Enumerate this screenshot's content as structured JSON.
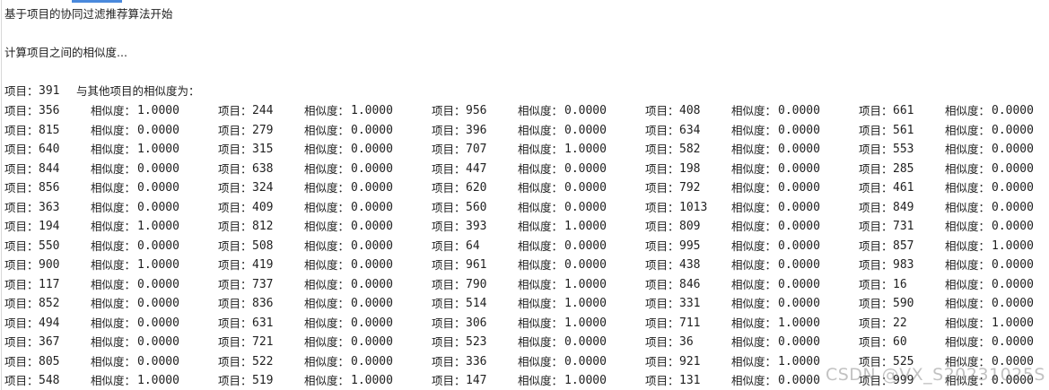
{
  "colors": {
    "background": "#ffffff",
    "text": "#1f1f1f",
    "tab_accent": "#4a89dc",
    "watermark": "#9a9a9a"
  },
  "console": {
    "line1": "基于项目的协同过滤推荐算法开始",
    "line2": "计算项目之间的相似度...",
    "header": {
      "item_label": "项目：",
      "item_id": "391",
      "suffix": "与其他项目的相似度为："
    },
    "item_label": "项目：",
    "sim_label": "相似度：",
    "rows": [
      [
        [
          "356",
          "1.0000"
        ],
        [
          "244",
          "1.0000"
        ],
        [
          "956",
          "0.0000"
        ],
        [
          "408",
          "0.0000"
        ],
        [
          "661",
          "0.0000"
        ]
      ],
      [
        [
          "815",
          "0.0000"
        ],
        [
          "279",
          "0.0000"
        ],
        [
          "396",
          "0.0000"
        ],
        [
          "634",
          "0.0000"
        ],
        [
          "561",
          "0.0000"
        ]
      ],
      [
        [
          "640",
          "1.0000"
        ],
        [
          "315",
          "0.0000"
        ],
        [
          "707",
          "1.0000"
        ],
        [
          "582",
          "0.0000"
        ],
        [
          "553",
          "0.0000"
        ]
      ],
      [
        [
          "844",
          "0.0000"
        ],
        [
          "638",
          "0.0000"
        ],
        [
          "447",
          "0.0000"
        ],
        [
          "198",
          "0.0000"
        ],
        [
          "285",
          "0.0000"
        ]
      ],
      [
        [
          "856",
          "0.0000"
        ],
        [
          "324",
          "0.0000"
        ],
        [
          "620",
          "0.0000"
        ],
        [
          "792",
          "0.0000"
        ],
        [
          "461",
          "0.0000"
        ]
      ],
      [
        [
          "363",
          "0.0000"
        ],
        [
          "409",
          "0.0000"
        ],
        [
          "560",
          "0.0000"
        ],
        [
          "1013",
          "0.0000"
        ],
        [
          "849",
          "0.0000"
        ]
      ],
      [
        [
          "194",
          "1.0000"
        ],
        [
          "812",
          "0.0000"
        ],
        [
          "393",
          "1.0000"
        ],
        [
          "809",
          "0.0000"
        ],
        [
          "731",
          "0.0000"
        ]
      ],
      [
        [
          "550",
          "0.0000"
        ],
        [
          "508",
          "0.0000"
        ],
        [
          "64",
          "0.0000"
        ],
        [
          "995",
          "0.0000"
        ],
        [
          "857",
          "1.0000"
        ]
      ],
      [
        [
          "900",
          "1.0000"
        ],
        [
          "419",
          "0.0000"
        ],
        [
          "961",
          "0.0000"
        ],
        [
          "438",
          "0.0000"
        ],
        [
          "983",
          "0.0000"
        ]
      ],
      [
        [
          "117",
          "0.0000"
        ],
        [
          "737",
          "0.0000"
        ],
        [
          "790",
          "1.0000"
        ],
        [
          "846",
          "0.0000"
        ],
        [
          "16",
          "0.0000"
        ]
      ],
      [
        [
          "852",
          "0.0000"
        ],
        [
          "836",
          "0.0000"
        ],
        [
          "514",
          "1.0000"
        ],
        [
          "331",
          "0.0000"
        ],
        [
          "590",
          "0.0000"
        ]
      ],
      [
        [
          "494",
          "0.0000"
        ],
        [
          "631",
          "0.0000"
        ],
        [
          "306",
          "1.0000"
        ],
        [
          "711",
          "1.0000"
        ],
        [
          "22",
          "1.0000"
        ]
      ],
      [
        [
          "367",
          "0.0000"
        ],
        [
          "721",
          "0.0000"
        ],
        [
          "523",
          "0.0000"
        ],
        [
          "36",
          "0.0000"
        ],
        [
          "60",
          "0.0000"
        ]
      ],
      [
        [
          "805",
          "0.0000"
        ],
        [
          "522",
          "0.0000"
        ],
        [
          "336",
          "0.0000"
        ],
        [
          "921",
          "1.0000"
        ],
        [
          "525",
          "0.0000"
        ]
      ],
      [
        [
          "548",
          "1.0000"
        ],
        [
          "519",
          "1.0000"
        ],
        [
          "147",
          "1.0000"
        ],
        [
          "131",
          "0.0000"
        ],
        [
          "999",
          "0.0000"
        ]
      ]
    ]
  },
  "watermark": "CSDN @VX_S20231025S"
}
